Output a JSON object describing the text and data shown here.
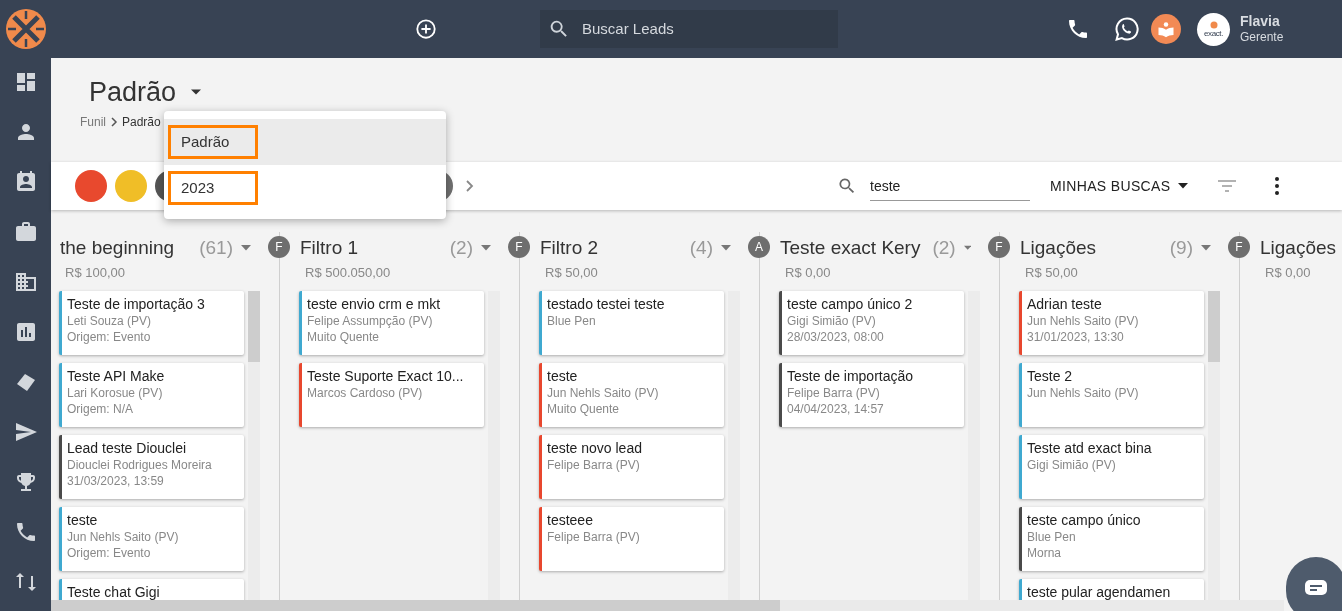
{
  "topbar": {
    "search": {
      "placeholder": "Buscar Leads"
    },
    "avatar_text": "exact.",
    "user": {
      "name": "Flavia",
      "role": "Gerente"
    }
  },
  "page": {
    "title": "Padrão",
    "breadcrumb": [
      "Funil",
      "Padrão"
    ]
  },
  "funnel_menu": [
    {
      "label": "Padrão",
      "selected": true,
      "annotated": true
    },
    {
      "label": "2023",
      "selected": false,
      "annotated": true
    }
  ],
  "toolbar": {
    "filters": [
      {
        "color": "#e8492e"
      },
      {
        "color": "#f0be27"
      },
      {
        "color": "#555555"
      }
    ],
    "search_value": "teste",
    "saved_searches": "MINHAS BUSCAS"
  },
  "columns": [
    {
      "title": "the beginning",
      "count": "(61)",
      "amount": "R$ 100,00",
      "scroll_thumb": true,
      "cards": [
        {
          "title": "Teste de importação 3",
          "lines": [
            "Leti Souza (PV)",
            "Origem: Evento"
          ],
          "color": "#3fa9d0"
        },
        {
          "title": "Teste API Make",
          "lines": [
            "Lari Korosue (PV)",
            "Origem: N/A"
          ],
          "color": "#3fa9d0"
        },
        {
          "title": "Lead teste Diouclei",
          "lines": [
            "Diouclei Rodrigues Moreira",
            "31/03/2023, 13:59"
          ],
          "color": "#4a4a4a"
        },
        {
          "title": "teste",
          "lines": [
            "Jun Nehls Saito (PV)",
            "Origem: Evento"
          ],
          "color": "#3fa9d0"
        },
        {
          "title": "Teste chat Gigi",
          "color": "#3fa9d0"
        }
      ]
    },
    {
      "title": "Filtro 1",
      "count": "(2)",
      "amount": "R$ 500.050,00",
      "badge": "F",
      "scroll_thumb": false,
      "cards": [
        {
          "title": "teste envio crm e mkt",
          "lines": [
            "Felipe Assumpção (PV)",
            "Muito Quente"
          ],
          "color": "#3fa9d0"
        },
        {
          "title": "Teste Suporte Exact 10...",
          "lines": [
            "Marcos Cardoso (PV)"
          ],
          "color": "#e8472e"
        }
      ]
    },
    {
      "title": "Filtro 2",
      "count": "(4)",
      "amount": "R$ 50,00",
      "badge": "F",
      "scroll_thumb": false,
      "cards": [
        {
          "title": "testado testei teste",
          "lines": [
            "Blue Pen"
          ],
          "color": "#3fa9d0"
        },
        {
          "title": "teste",
          "lines": [
            "Jun Nehls Saito (PV)",
            "Muito Quente"
          ],
          "color": "#e8472e"
        },
        {
          "title": "teste novo lead",
          "lines": [
            "Felipe Barra (PV)"
          ],
          "color": "#e8472e"
        },
        {
          "title": "testeee",
          "lines": [
            "Felipe Barra (PV)"
          ],
          "color": "#e8472e"
        }
      ]
    },
    {
      "title": "Teste exact Kery",
      "count": "(2)",
      "amount": "R$ 0,00",
      "badge": "A",
      "scroll_thumb": false,
      "cards": [
        {
          "title": "teste campo único 2",
          "lines": [
            "Gigi Simião (PV)",
            "28/03/2023, 08:00"
          ],
          "color": "#4a4a4a"
        },
        {
          "title": "Teste de importação",
          "lines": [
            "Felipe Barra (PV)",
            "04/04/2023, 14:57"
          ],
          "color": "#4a4a4a"
        }
      ]
    },
    {
      "title": "Ligações",
      "count": "(9)",
      "amount": "R$ 50,00",
      "badge": "F",
      "scroll_thumb": true,
      "cards": [
        {
          "title": "Adrian teste",
          "lines": [
            "Jun Nehls Saito (PV)",
            "31/01/2023, 13:30"
          ],
          "color": "#e8472e"
        },
        {
          "title": "Teste 2",
          "lines": [
            "Jun Nehls Saito (PV)"
          ],
          "color": "#3fa9d0"
        },
        {
          "title": "Teste atd exact bina",
          "lines": [
            "Gigi Simião (PV)"
          ],
          "color": "#3fa9d0"
        },
        {
          "title": "teste campo único",
          "lines": [
            "Blue Pen",
            "Morna"
          ],
          "color": "#4a4a4a"
        },
        {
          "title": "teste pular agendamen",
          "color": "#3fa9d0"
        }
      ]
    },
    {
      "title": "Ligações",
      "amount": "R$ 0,00",
      "badge": "F"
    }
  ]
}
